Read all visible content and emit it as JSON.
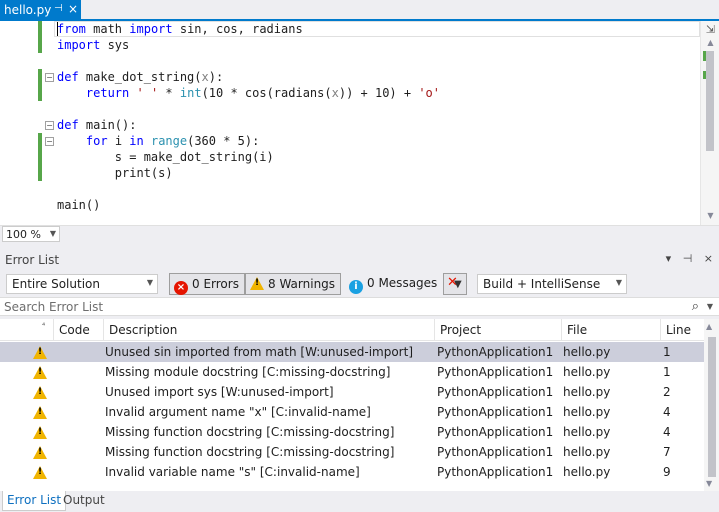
{
  "doc_tab": {
    "name": "hello.py",
    "pin": "⊣",
    "close": "×"
  },
  "code_lines": [
    [
      [
        "kw",
        "from"
      ],
      [
        "t",
        " math "
      ],
      [
        "kw",
        "import"
      ],
      [
        "t",
        " sin, cos, radians"
      ]
    ],
    [
      [
        "kw",
        "import"
      ],
      [
        "t",
        " sys"
      ]
    ],
    [],
    [
      [
        "kw",
        "def"
      ],
      [
        "t",
        " make_dot_string("
      ],
      [
        "prm",
        "x"
      ],
      [
        "t",
        "):"
      ]
    ],
    [
      [
        "t",
        "    "
      ],
      [
        "kw",
        "return"
      ],
      [
        "t",
        " "
      ],
      [
        "str",
        "' '"
      ],
      [
        "t",
        " * "
      ],
      [
        "bi",
        "int"
      ],
      [
        "t",
        "(10 * cos(radians("
      ],
      [
        "prm",
        "x"
      ],
      [
        "t",
        ")) + 10) + "
      ],
      [
        "str",
        "'o'"
      ]
    ],
    [],
    [
      [
        "kw",
        "def"
      ],
      [
        "t",
        " main():"
      ]
    ],
    [
      [
        "t",
        "    "
      ],
      [
        "kw",
        "for"
      ],
      [
        "t",
        " i "
      ],
      [
        "kw",
        "in"
      ],
      [
        "t",
        " "
      ],
      [
        "bi",
        "range"
      ],
      [
        "t",
        "(360 * 5):"
      ]
    ],
    [
      [
        "t",
        "        s = make_dot_string(i)"
      ]
    ],
    [
      [
        "t",
        "        print(s)"
      ]
    ],
    [],
    [
      [
        "t",
        "main()"
      ]
    ]
  ],
  "zoom": {
    "value": "100 %"
  },
  "error_list": {
    "title": "Error List",
    "title_buttons": [
      "▾",
      "⊣",
      "×"
    ],
    "scope": "Entire Solution",
    "errors_label": "0 Errors",
    "warnings_label": "8 Warnings",
    "messages_label": "0 Messages",
    "source": "Build + IntelliSense",
    "search_placeholder": "Search Error List",
    "columns": {
      "code": "Code",
      "description": "Description",
      "project": "Project",
      "file": "File",
      "line": "Line"
    },
    "rows": [
      {
        "description": "Unused sin imported from math [W:unused-import]",
        "project": "PythonApplication1",
        "file": "hello.py",
        "line": "1",
        "selected": true
      },
      {
        "description": "Missing module docstring [C:missing-docstring]",
        "project": "PythonApplication1",
        "file": "hello.py",
        "line": "1"
      },
      {
        "description": "Unused import sys [W:unused-import]",
        "project": "PythonApplication1",
        "file": "hello.py",
        "line": "2"
      },
      {
        "description": "Invalid argument name \"x\" [C:invalid-name]",
        "project": "PythonApplication1",
        "file": "hello.py",
        "line": "4"
      },
      {
        "description": "Missing function docstring [C:missing-docstring]",
        "project": "PythonApplication1",
        "file": "hello.py",
        "line": "4"
      },
      {
        "description": "Missing function docstring [C:missing-docstring]",
        "project": "PythonApplication1",
        "file": "hello.py",
        "line": "7"
      },
      {
        "description": "Invalid variable name \"s\" [C:invalid-name]",
        "project": "PythonApplication1",
        "file": "hello.py",
        "line": "9"
      }
    ]
  },
  "bottom_tabs": [
    "Error List",
    "Output"
  ]
}
